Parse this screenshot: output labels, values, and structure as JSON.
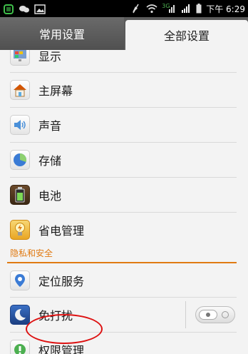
{
  "status_bar": {
    "time": "下午 6:29",
    "network_label": "3G",
    "icons": [
      "app-icon",
      "message-icon",
      "image-icon",
      "mute-icon",
      "wifi-icon",
      "signal-3g-icon",
      "signal-icon",
      "battery-icon"
    ]
  },
  "tabs": [
    {
      "label": "常用设置",
      "selected": false
    },
    {
      "label": "全部设置",
      "selected": true
    }
  ],
  "items": [
    {
      "label": "显示",
      "icon": "display-icon"
    },
    {
      "label": "主屏幕",
      "icon": "home-screen-icon"
    },
    {
      "label": "声音",
      "icon": "sound-icon"
    },
    {
      "label": "存储",
      "icon": "storage-icon"
    },
    {
      "label": "电池",
      "icon": "battery-settings-icon"
    },
    {
      "label": "省电管理",
      "icon": "power-saving-icon"
    }
  ],
  "section": {
    "title": "隐私和安全"
  },
  "privacy_items": [
    {
      "label": "定位服务",
      "icon": "location-icon"
    },
    {
      "label": "免打扰",
      "icon": "do-not-disturb-icon",
      "toggle": "off"
    },
    {
      "label": "权限管理",
      "icon": "permissions-icon",
      "highlighted": true
    }
  ],
  "colors": {
    "accent": "#e07a12",
    "highlight": "#d11111"
  }
}
